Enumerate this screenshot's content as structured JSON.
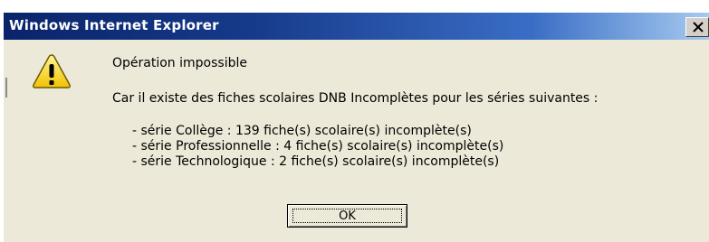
{
  "dialog": {
    "title": "Windows Internet Explorer",
    "icon": "warning-icon",
    "message_heading": "Opération impossible",
    "message_body": "Car il existe des fiches scolaires DNB Incomplètes pour les séries suivantes :",
    "items": [
      "- série Collège : 139 fiche(s) scolaire(s) incomplète(s)",
      "- série Professionnelle : 4 fiche(s) scolaire(s) incomplète(s)",
      "- série Technologique : 2 fiche(s) scolaire(s) incomplète(s)"
    ],
    "ok_label": "OK",
    "close_label": "X"
  },
  "colors": {
    "titlebar_start": "#0a246a",
    "titlebar_end": "#a6caf0",
    "dialog_bg": "#ece9d8",
    "warning_fill": "#ffe600"
  }
}
